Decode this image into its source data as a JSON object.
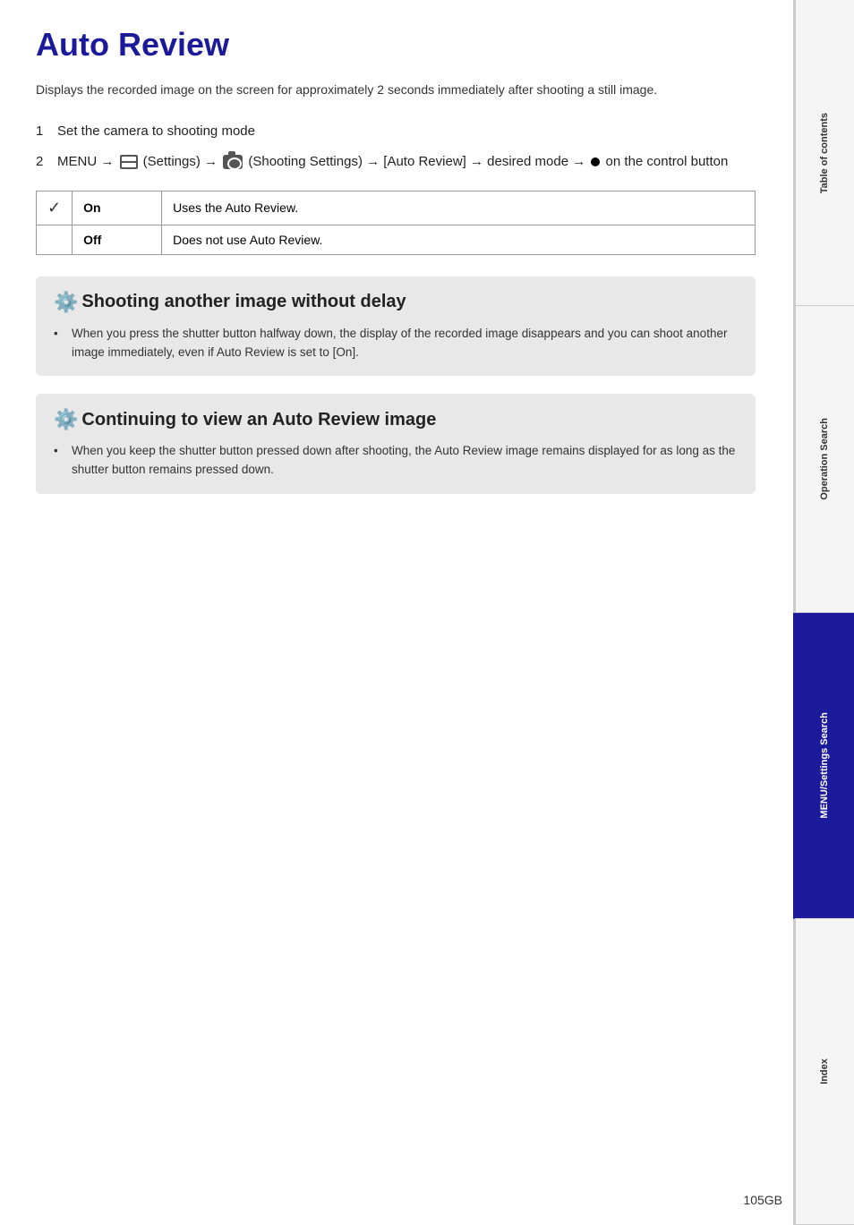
{
  "page": {
    "title": "Auto Review",
    "intro": "Displays the recorded image on the screen for approximately 2 seconds immediately after shooting a still image.",
    "steps": [
      {
        "num": "1",
        "text": "Set the camera to shooting mode"
      },
      {
        "num": "2",
        "text_prefix": "MENU → ",
        "text_settings": "(Settings) → ",
        "text_camera": "(Shooting Settings) → [Auto Review] → desired mode → ",
        "text_suffix": " on the control button"
      }
    ],
    "table": {
      "rows": [
        {
          "checked": true,
          "option": "On",
          "description": "Uses the Auto Review."
        },
        {
          "checked": false,
          "option": "Off",
          "description": "Does not use Auto Review."
        }
      ]
    },
    "tips": [
      {
        "id": "tip1",
        "title": "Shooting another image without delay",
        "body": "When you press the shutter button halfway down, the display of the recorded image disappears and you can shoot another image immediately, even if Auto Review is set to [On]."
      },
      {
        "id": "tip2",
        "title": "Continuing to view an Auto Review image",
        "body": "When you keep the shutter button pressed down after shooting, the Auto Review image remains displayed for as long as the shutter button remains pressed down."
      }
    ],
    "page_number": "105GB"
  },
  "side_nav": {
    "items": [
      {
        "id": "table-of-contents",
        "label": "Table of\ncontents",
        "active": false
      },
      {
        "id": "operation-search",
        "label": "Operation\nSearch",
        "active": false
      },
      {
        "id": "menu-settings-search",
        "label": "MENU/Settings\nSearch",
        "active": true
      },
      {
        "id": "index",
        "label": "Index",
        "active": false
      }
    ]
  }
}
